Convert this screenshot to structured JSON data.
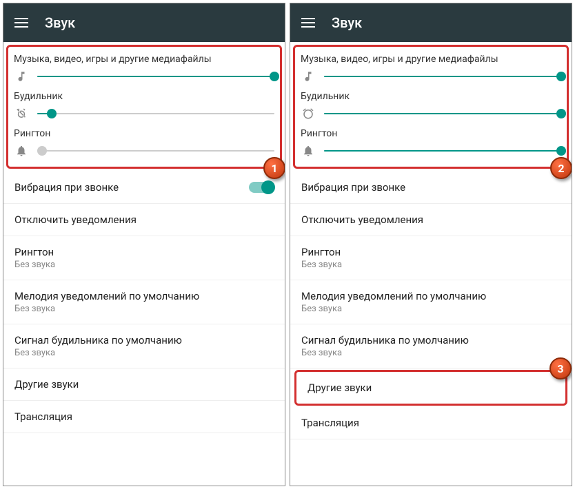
{
  "appbar": {
    "title": "Звук"
  },
  "sliders": {
    "media": {
      "label": "Музыка, видео, игры и другие медиафайлы"
    },
    "alarm": {
      "label": "Будильник"
    },
    "ringtone": {
      "label": "Рингтон"
    }
  },
  "left": {
    "media_pct": 100,
    "alarm_pct": 6,
    "ring_pct": 2
  },
  "right": {
    "media_pct": 100,
    "alarm_pct": 100,
    "ring_pct": 100
  },
  "items": {
    "vibrate": "Вибрация при звонке",
    "dnd": "Отключить уведомления",
    "ringtone": {
      "title": "Рингтон",
      "sub": "Без звука"
    },
    "notif": {
      "title": "Мелодия уведомлений по умолчанию",
      "sub": "Без звука"
    },
    "alarm": {
      "title": "Сигнал будильника по умолчанию",
      "sub": "Без звука"
    },
    "other": "Другие звуки",
    "cast": "Трансляция"
  },
  "markers": {
    "one": "1",
    "two": "2",
    "three": "3"
  }
}
